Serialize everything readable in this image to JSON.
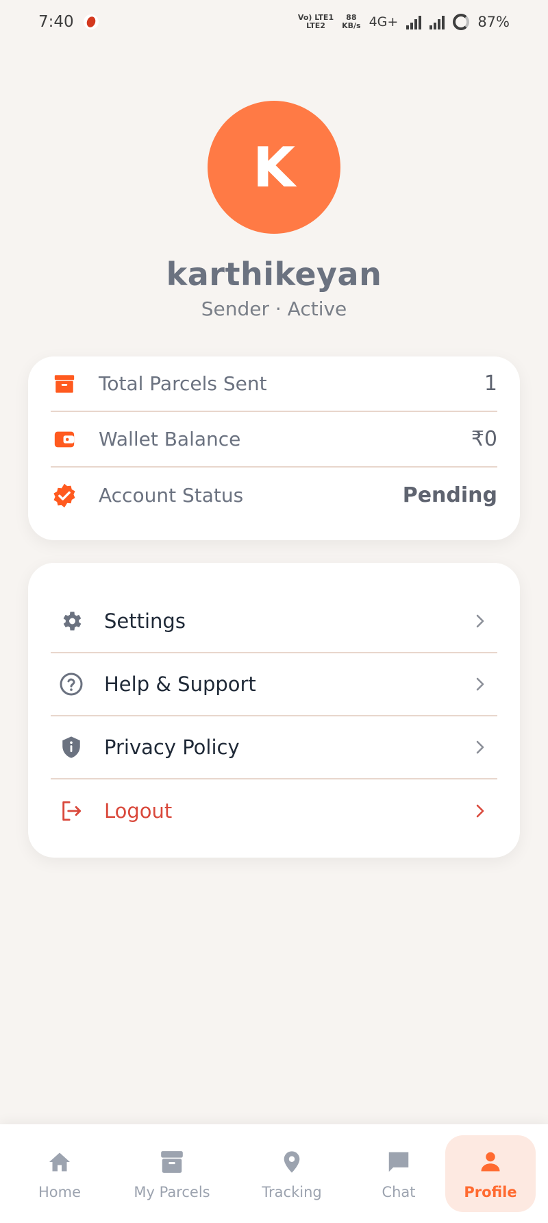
{
  "status_bar": {
    "time": "7:40",
    "network_top": "Vo) LTE1",
    "network_bottom": "LTE2",
    "speed_value": "88",
    "speed_unit": "KB/s",
    "network_type": "4G+",
    "battery": "87%"
  },
  "profile": {
    "initial": "K",
    "name": "karthikeyan",
    "role_status": "Sender · Active"
  },
  "stats": [
    {
      "icon": "archive-icon",
      "label": "Total Parcels Sent",
      "value": "1"
    },
    {
      "icon": "wallet-icon",
      "label": "Wallet Balance",
      "value": "₹0"
    },
    {
      "icon": "verified-badge-icon",
      "label": "Account Status",
      "value": "Pending"
    }
  ],
  "menu": [
    {
      "icon": "gear-icon",
      "label": "Settings"
    },
    {
      "icon": "help-circle-icon",
      "label": "Help & Support"
    },
    {
      "icon": "shield-info-icon",
      "label": "Privacy Policy"
    },
    {
      "icon": "logout-icon",
      "label": "Logout"
    }
  ],
  "bottom_nav": [
    {
      "icon": "home-icon",
      "label": "Home"
    },
    {
      "icon": "archive-icon",
      "label": "My Parcels"
    },
    {
      "icon": "location-pin-icon",
      "label": "Tracking"
    },
    {
      "icon": "chat-icon",
      "label": "Chat"
    },
    {
      "icon": "person-icon",
      "label": "Profile",
      "active": true
    }
  ],
  "colors": {
    "accent": "#ff7a45",
    "danger": "#d9483b",
    "background": "#f7f4f1",
    "divider": "#e8d6cc"
  }
}
